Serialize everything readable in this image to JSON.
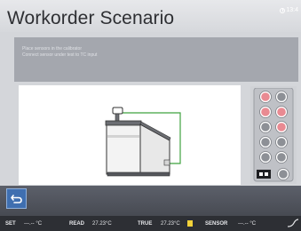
{
  "header": {
    "title": "Workorder Scenario",
    "clock_text": "13:4"
  },
  "instruction": {
    "line1": "Place sensors in the calibrator",
    "line2": "Connect sensor under test to TC input"
  },
  "status": {
    "set_label": "SET",
    "set_value": "---.-- °C",
    "read_label": "READ",
    "read_value": "27.23°C",
    "true_label": "TRUE",
    "true_value": "27.23°C",
    "sensor_label": "SENSOR",
    "sensor_value": "---.-- °C"
  },
  "connector_panel": {
    "terminals": [
      "red",
      "grey",
      "red",
      "red",
      "grey",
      "red",
      "grey",
      "grey",
      "grey",
      "grey"
    ],
    "accent_red": "#e98a92",
    "grey": "#8d9096"
  },
  "icons": {
    "back": "back-arrow-icon",
    "clock": "clock-icon"
  }
}
